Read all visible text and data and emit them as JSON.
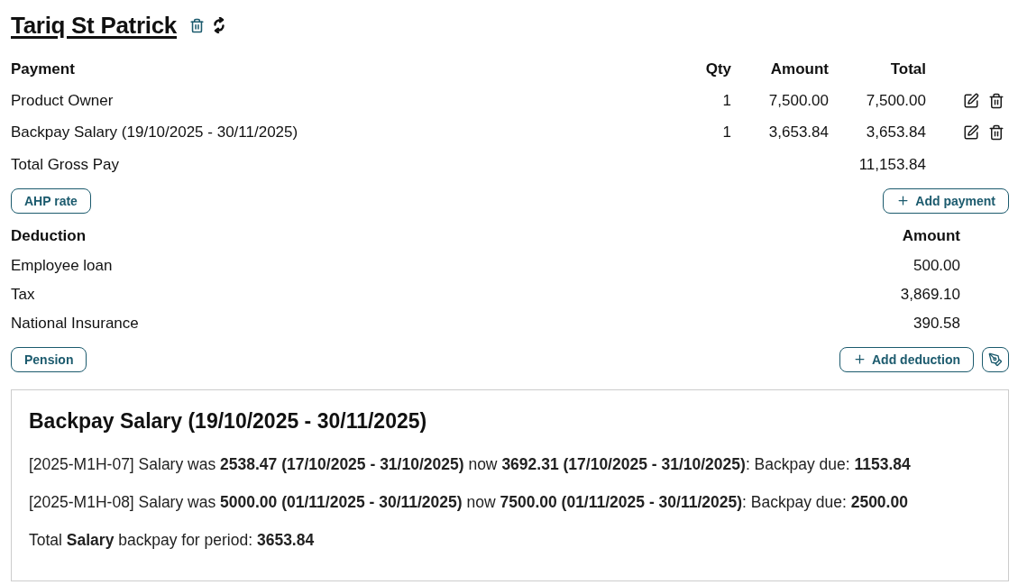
{
  "employee": {
    "name": "Tariq St Patrick"
  },
  "payment_table": {
    "columns": [
      "Payment",
      "Qty",
      "Amount",
      "Total"
    ],
    "rows": [
      {
        "description": "Product Owner",
        "qty": "1",
        "amount": "7,500.00",
        "total": "7,500.00"
      },
      {
        "description": "Backpay Salary (19/10/2025 - 30/11/2025)",
        "qty": "1",
        "amount": "3,653.84",
        "total": "3,653.84"
      }
    ],
    "gross_total": {
      "label": "Total Gross Pay",
      "total": "11,153.84"
    },
    "buttons": [
      {
        "kind": "plain",
        "label": "AHP rate"
      },
      {
        "kind": "add",
        "label": "Add payment"
      }
    ]
  },
  "deduction_table": {
    "columns": [
      "Deduction",
      "Amount"
    ],
    "rows": [
      {
        "description": "Employee loan",
        "amount": "500.00"
      },
      {
        "description": "Tax",
        "amount": "3,869.10"
      },
      {
        "description": "National Insurance",
        "amount": "390.58"
      }
    ],
    "buttons": [
      {
        "kind": "plain",
        "label": "Pension"
      },
      {
        "kind": "add",
        "label": "Add deduction"
      },
      {
        "kind": "pen"
      }
    ]
  },
  "backpay_panel": {
    "title": "Backpay Salary (19/10/2025 - 30/11/2025)",
    "lines": [
      "[2025-M1H-07] Salary was **2538.47 (17/10/2025 - 31/10/2025)** now **3692.31 (17/10/2025 - 31/10/2025)**: Backpay due: **1153.84**",
      "[2025-M1H-08] Salary was **5000.00 (01/11/2025 - 30/11/2025)** now **7500.00 (01/11/2025 - 30/11/2025)**: Backpay due: **2500.00**",
      "Total **Salary** backpay for period: **3653.84**"
    ]
  }
}
